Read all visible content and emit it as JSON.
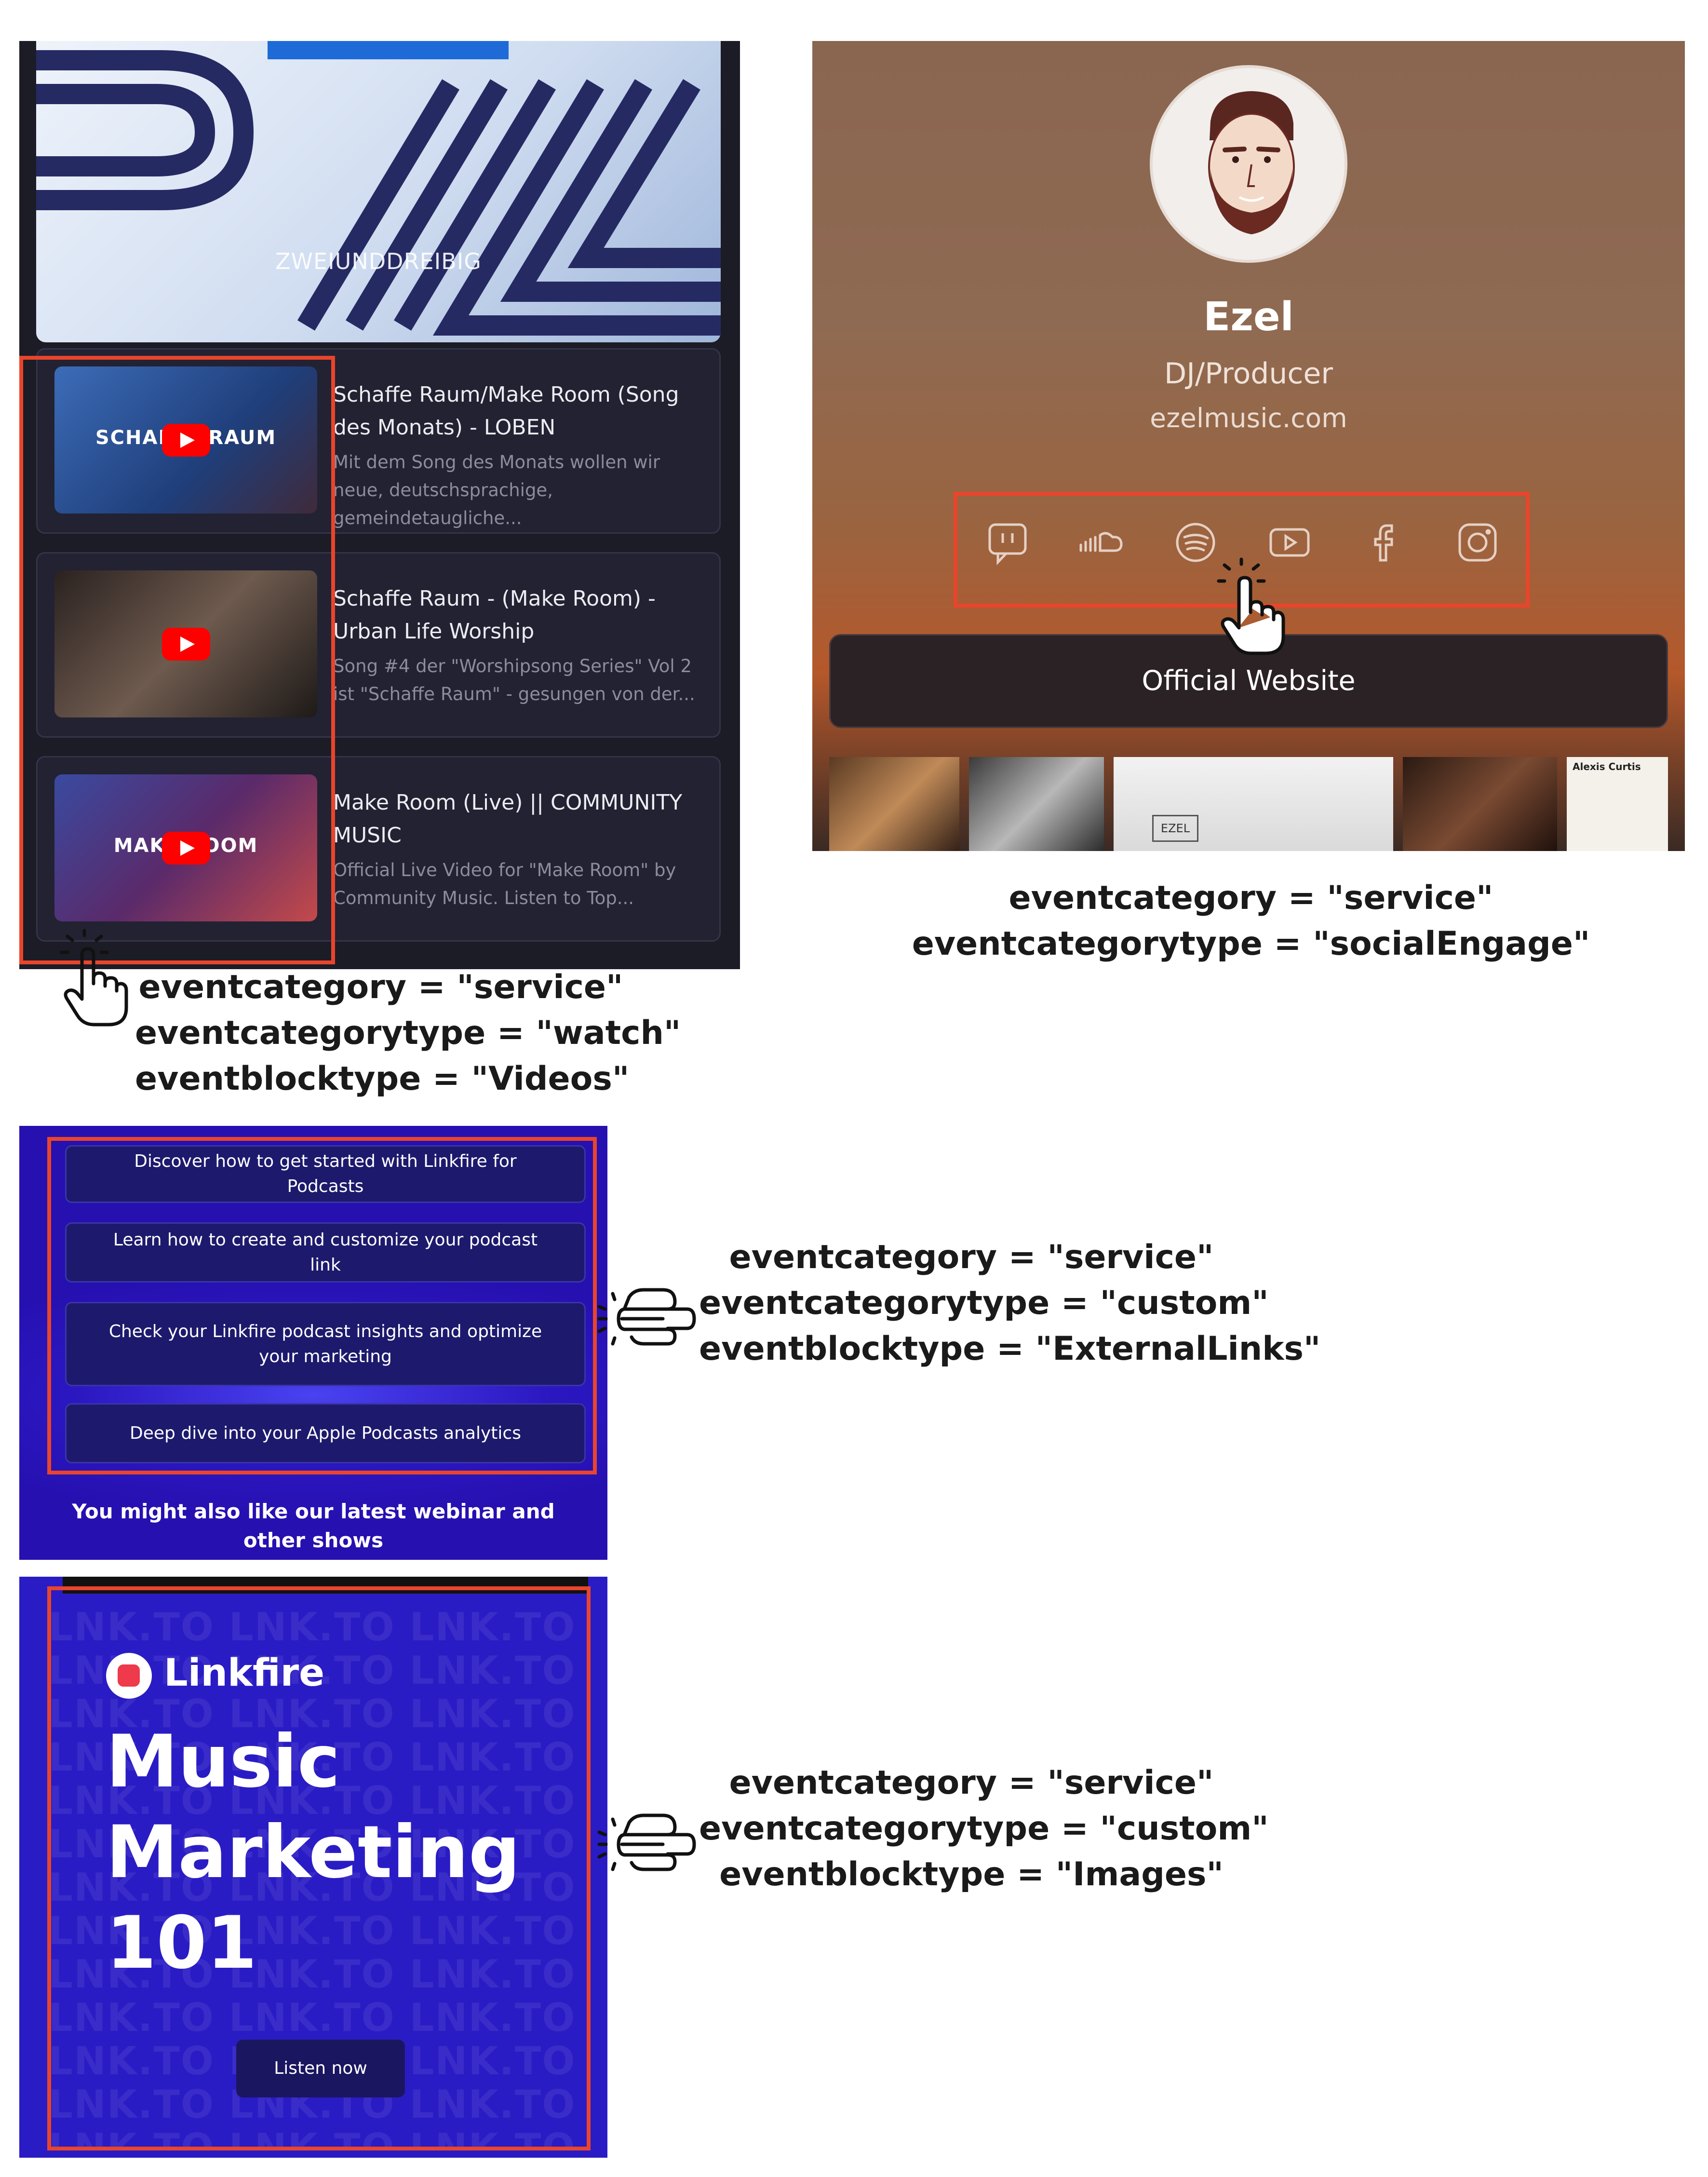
{
  "videos_panel": {
    "hero_text": "ZWEIUNDDREIBIG",
    "items": [
      {
        "thumb_text": "SCHAFFE RAUM",
        "title": "Schaffe Raum/Make Room (Song des Monats) - LOBEN",
        "desc": "Mit dem Song des Monats wollen wir neue, deutschsprachige, gemeindetaugliche..."
      },
      {
        "thumb_text": "",
        "title": "Schaffe Raum - (Make Room) - Urban Life Worship",
        "desc": "Song #4 der \"Worshipsong Series\" Vol 2 ist \"Schaffe Raum\" - gesungen von der..."
      },
      {
        "thumb_text": "MAKE ROOM",
        "title": "Make Room (Live) || COMMUNITY MUSIC",
        "desc": "Official Live Video for \"Make Room\" by Community Music. Listen to Top..."
      }
    ],
    "caption": [
      "eventcategory = \"service\"",
      "eventcategorytype = \"watch\"",
      "eventblocktype = \"Videos\""
    ]
  },
  "profile_panel": {
    "name": "Ezel",
    "role": "DJ/Producer",
    "website": "ezelmusic.com",
    "social_icons": [
      "twitch-icon",
      "soundcloud-icon",
      "spotify-icon",
      "youtube-icon",
      "facebook-icon",
      "instagram-icon"
    ],
    "button_label": "Official Website",
    "strip_label": "EZEL",
    "strip_text_label": "Alexis Curtis",
    "caption": [
      "eventcategory = \"service\"",
      "eventcategorytype = \"socialEngage\""
    ]
  },
  "links_panel": {
    "links": [
      "Discover how to get started with Linkfire for Podcasts",
      "Learn how to create and customize your podcast link",
      "Check your Linkfire podcast insights and optimize your marketing",
      "Deep dive into your Apple Podcasts analytics"
    ],
    "footer": "You might also like our latest webinar and other shows",
    "caption": [
      "eventcategory = \"service\"",
      "eventcategorytype = \"custom\"",
      "eventblocktype = \"ExternalLinks\""
    ]
  },
  "image_panel": {
    "logo_text": "Linkfire",
    "title_lines": [
      "Music",
      "Marketing",
      "101"
    ],
    "button_label": "Listen now",
    "pattern_text": "LNK.TO LNK.TO LNK.TO LNK.TO",
    "caption": [
      "eventcategory = \"service\"",
      "eventcategorytype = \"custom\"",
      "eventblocktype = \"Images\""
    ]
  },
  "colors": {
    "highlight": "#e8452c",
    "linkfire_blue": "#2a1cc4"
  }
}
